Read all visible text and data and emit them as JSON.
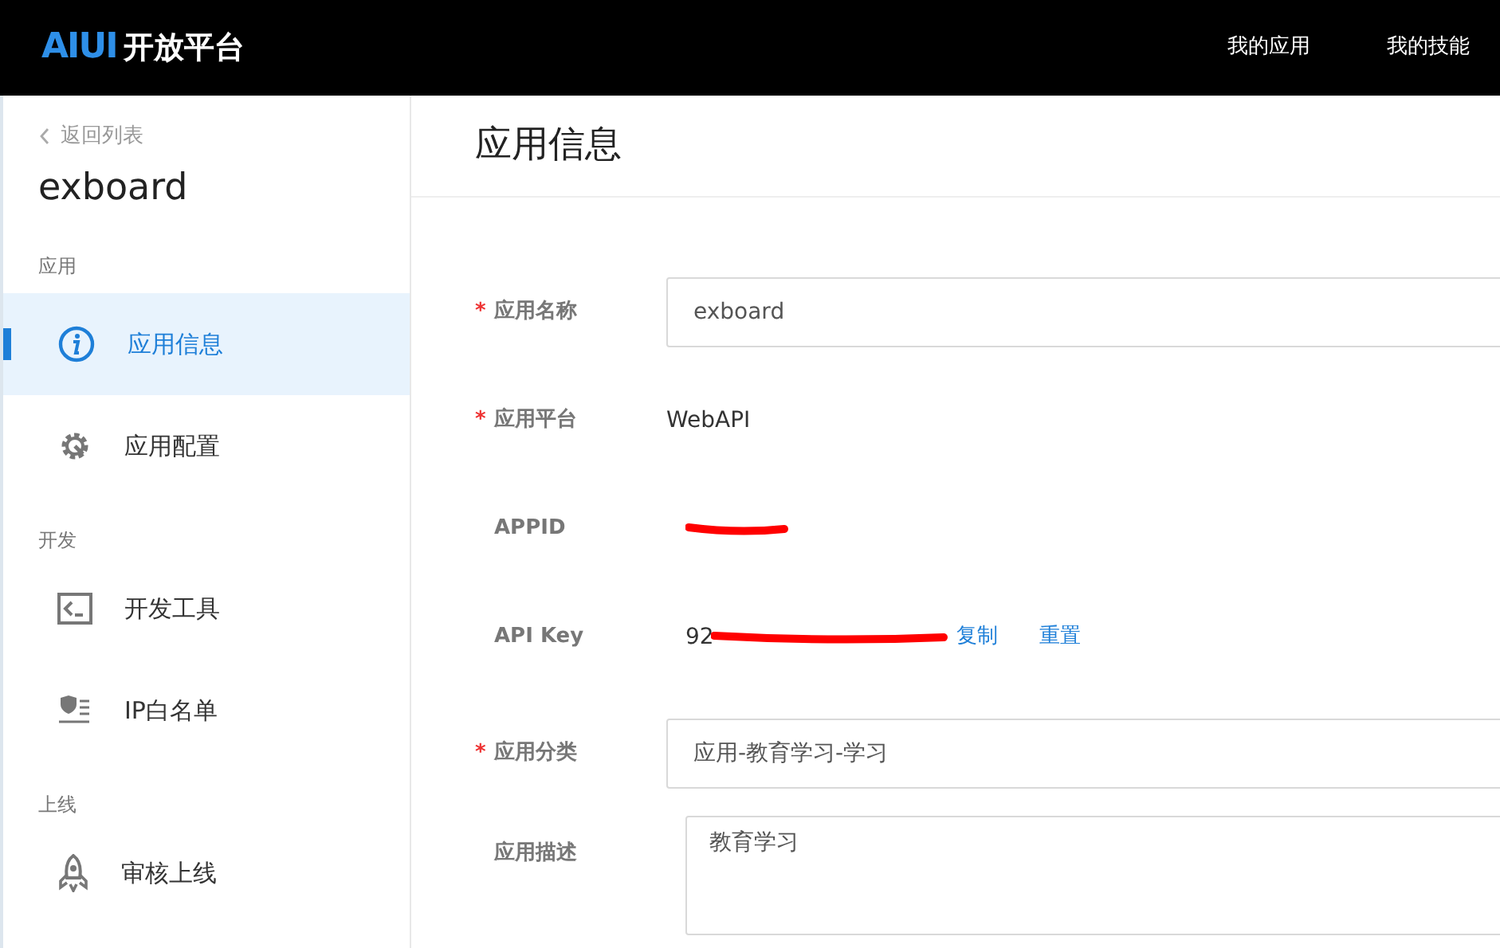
{
  "header": {
    "logo_mark": "AIUI",
    "logo_text": "开放平台",
    "nav": [
      {
        "label": "我的应用"
      },
      {
        "label": "我的技能"
      }
    ]
  },
  "sidebar": {
    "back": "返回列表",
    "app_name": "exboard",
    "sections": [
      {
        "title": "应用",
        "items": [
          {
            "label": "应用信息",
            "kind": "info",
            "selected": true
          },
          {
            "label": "应用配置",
            "kind": "gear",
            "selected": false
          }
        ]
      },
      {
        "title": "开发",
        "items": [
          {
            "label": "开发工具",
            "kind": "terminal",
            "selected": false
          },
          {
            "label": "IP白名单",
            "kind": "shield-list",
            "selected": false
          }
        ]
      },
      {
        "title": "上线",
        "items": [
          {
            "label": "审核上线",
            "kind": "rocket",
            "selected": false
          }
        ]
      }
    ]
  },
  "main": {
    "title": "应用信息",
    "fields": [
      {
        "label": "应用名称",
        "required_mark": "*",
        "kind": "input",
        "value": "exboard"
      },
      {
        "label": "应用平台",
        "required_mark": "*",
        "kind": "text",
        "value": "WebAPI"
      },
      {
        "label": "APPID",
        "kind": "text",
        "redacted": true
      },
      {
        "label": "API Key",
        "kind": "text",
        "value": "92",
        "redacted": true,
        "actions": [
          "复制",
          "重置"
        ]
      },
      {
        "label": "应用分类",
        "required_mark": "*",
        "kind": "input",
        "value": "应用-教育学习-学习"
      },
      {
        "label": "应用描述",
        "kind": "textarea",
        "value": "教育学习"
      }
    ]
  }
}
